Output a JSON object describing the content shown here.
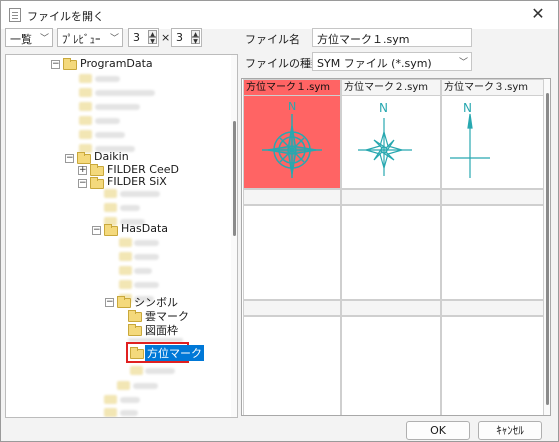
{
  "window": {
    "title": "ファイルを開く",
    "close_glyph": "✕"
  },
  "toolbar": {
    "view_mode": "一覧",
    "preview_mode": "ﾌﾟﾚﾋﾞｭｰ",
    "columns": "3",
    "rows": "3",
    "times": "×"
  },
  "tree": {
    "nodes": [
      {
        "label": "ProgramData"
      },
      {
        "label": "Daikin"
      },
      {
        "label": "FILDER CeeD"
      },
      {
        "label": "FILDER SiX"
      },
      {
        "label": "HasData"
      },
      {
        "label": "シンボル"
      },
      {
        "label": "雲マーク"
      },
      {
        "label": "図面枠"
      },
      {
        "label": "方位マーク"
      }
    ],
    "selected": "方位マーク"
  },
  "form": {
    "filename_label": "ファイル名",
    "filename_value": "方位マーク１.sym",
    "filetype_label": "ファイルの種類",
    "filetype_value": "SYM ファイル (*.sym)"
  },
  "grid": {
    "items": [
      {
        "name": "方位マーク１.sym",
        "selected": true,
        "icon": "compass-rose-icon",
        "north": "N"
      },
      {
        "name": "方位マーク２.sym",
        "selected": false,
        "icon": "compass-star-icon",
        "north": "N"
      },
      {
        "name": "方位マーク３.sym",
        "selected": false,
        "icon": "compass-cross-icon",
        "north": "N"
      }
    ]
  },
  "buttons": {
    "ok": "OK",
    "cancel": "ｷｬﾝｾﾙ"
  },
  "colors": {
    "selection": "#ff6464",
    "symbol": "#28a8b0",
    "tree_selection": "#0078d7"
  }
}
